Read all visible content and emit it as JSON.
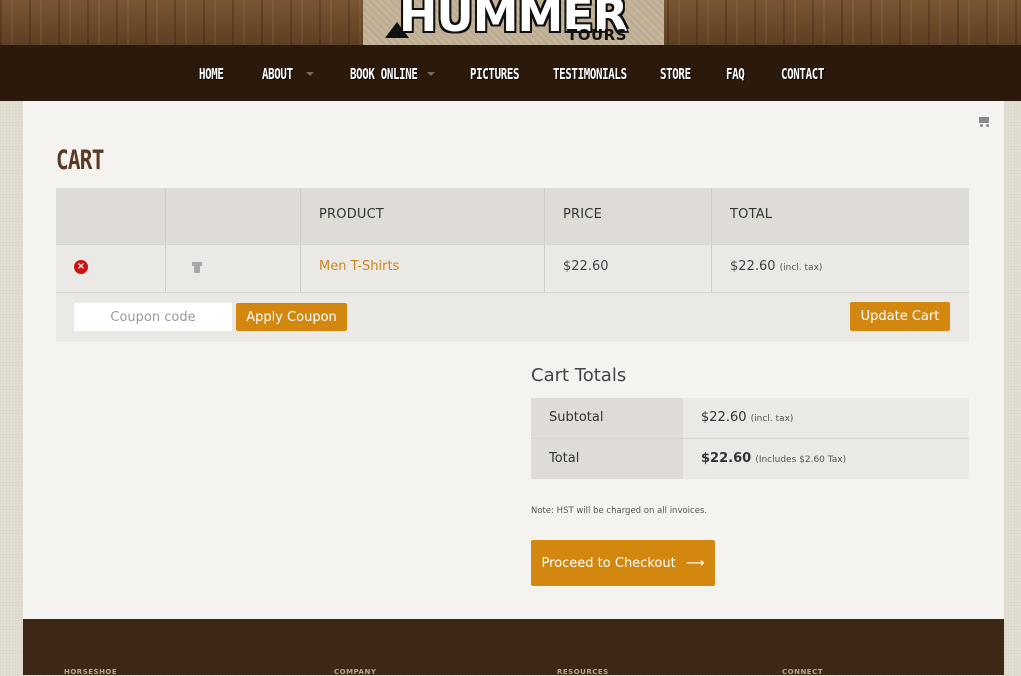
{
  "logo": {
    "main": "HUMMER",
    "sub": "TOURS"
  },
  "nav": {
    "items": [
      {
        "label": "HOME"
      },
      {
        "label": "ABOUT"
      },
      {
        "label": "BOOK ONLINE"
      },
      {
        "label": "PICTURES"
      },
      {
        "label": "TESTIMONIALS"
      },
      {
        "label": "STORE"
      },
      {
        "label": "FAQ"
      },
      {
        "label": "CONTACT"
      }
    ]
  },
  "page": {
    "title": "CART"
  },
  "cart_table": {
    "headers": {
      "product": "PRODUCT",
      "price": "PRICE",
      "total": "TOTAL"
    },
    "rows": [
      {
        "remove": "×",
        "product": "Men T-Shirts",
        "price": "$22.60",
        "total": "$22.60",
        "total_note": "(incl. tax)"
      }
    ]
  },
  "coupon": {
    "placeholder": "Coupon code",
    "apply_label": "Apply Coupon"
  },
  "update_label": "Update Cart",
  "totals": {
    "title": "Cart Totals",
    "subtotal_label": "Subtotal",
    "subtotal_value": "$22.60",
    "subtotal_note": "(incl. tax)",
    "total_label": "Total",
    "total_value": "$22.60",
    "total_note": "(Includes $2.60 Tax)"
  },
  "note": "Note: HST will be charged on all invoices.",
  "checkout": {
    "label": "Proceed to Checkout",
    "arrow": "⟶"
  },
  "footer": {
    "cols": [
      "HORSESHOE",
      "COMPANY",
      "RESOURCES",
      "CONNECT"
    ]
  },
  "colors": {
    "accent": "#d4870f",
    "link": "#c9871e",
    "nav_bg": "#2b1a0c",
    "footer_bg": "#3d2817",
    "remove": "#cc1111"
  }
}
